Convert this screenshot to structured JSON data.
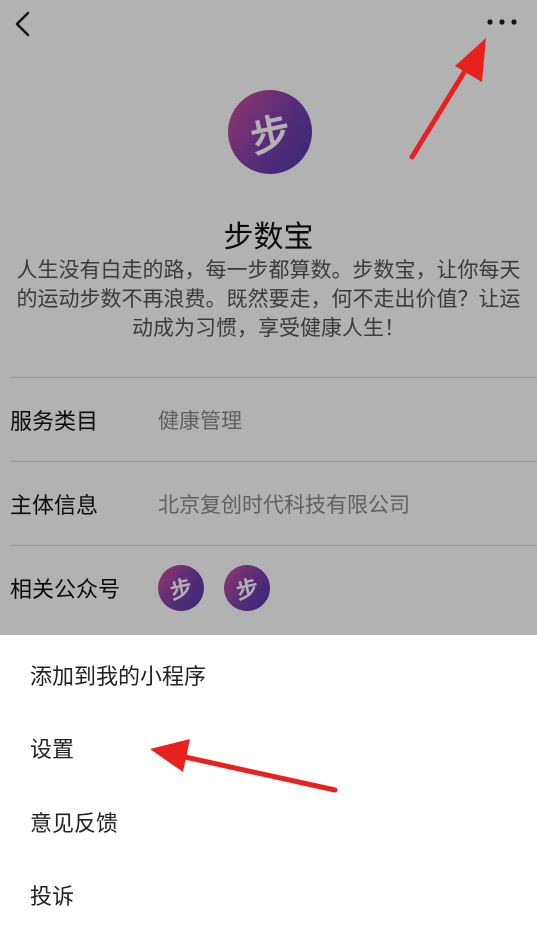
{
  "topbar": {
    "back_icon": "chevron-left-icon",
    "more_icon": "more-dots-icon"
  },
  "app": {
    "logo_glyph": "步",
    "name": "步数宝",
    "description": "人生没有白走的路，每一步都算数。步数宝，让你每天的运动步数不再浪费。既然要走，何不走出价值？让运动成为习惯，享受健康人生！"
  },
  "info": {
    "service_category": {
      "label": "服务类目",
      "value": "健康管理"
    },
    "entity": {
      "label": "主体信息",
      "value": "北京复创时代科技有限公司"
    },
    "related_accounts": {
      "label": "相关公众号",
      "icons": [
        "步",
        "步"
      ]
    }
  },
  "menu": {
    "items": [
      {
        "label": "添加到我的小程序"
      },
      {
        "label": "设置"
      },
      {
        "label": "意见反馈"
      },
      {
        "label": "投诉"
      }
    ]
  },
  "colors": {
    "brand_gradient_start": "#d4509a",
    "brand_gradient_end": "#4b3aa8",
    "overlay": "rgba(0,0,0,0.30)",
    "annotation_arrow": "#e8211f"
  }
}
